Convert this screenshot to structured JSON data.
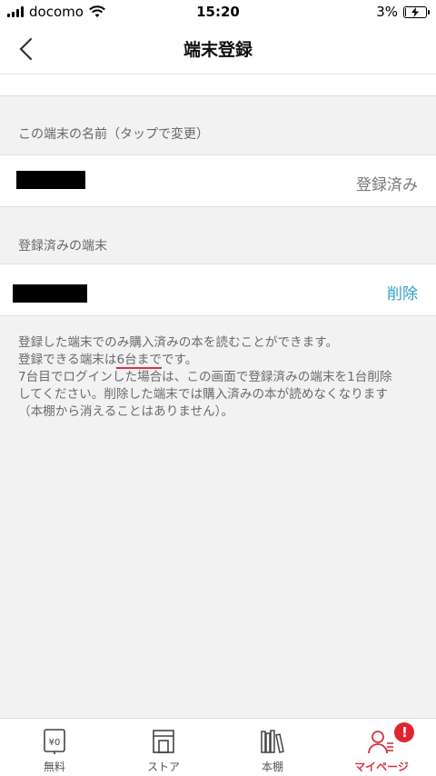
{
  "status_bar": {
    "carrier": "docomo",
    "time": "15:20",
    "battery": "3%",
    "battery_level": 0.03
  },
  "nav": {
    "title": "端末登録"
  },
  "device_name_section": {
    "label": "この端末の名前（タップで変更）",
    "status": "登録済み"
  },
  "registered_section": {
    "label": "登録済みの端末",
    "delete_label": "削除"
  },
  "info": {
    "line1": "登録した端末でのみ購入済みの本を読むことができます。",
    "line2_pre": "登録できる端末は",
    "line2_emph": "6台まで",
    "line2_post": "です。",
    "line3": "7台目でログインした場合は、この画面で登録済みの端末を1台削除",
    "line4": "してください。削除した端末では購入済みの本が読めなくなります",
    "line5": "（本棚から消えることはありません）。"
  },
  "tabbar": {
    "items": [
      {
        "label": "無料",
        "icon": "yen-tag-icon",
        "icon_text": "¥0"
      },
      {
        "label": "ストア",
        "icon": "store-icon"
      },
      {
        "label": "本棚",
        "icon": "bookshelf-icon"
      },
      {
        "label": "マイページ",
        "icon": "mypage-icon",
        "badge": "!"
      }
    ],
    "active_color": "#d9323f"
  },
  "colors": {
    "accent_blue": "#2fa0c6",
    "accent_red": "#d9323f"
  }
}
